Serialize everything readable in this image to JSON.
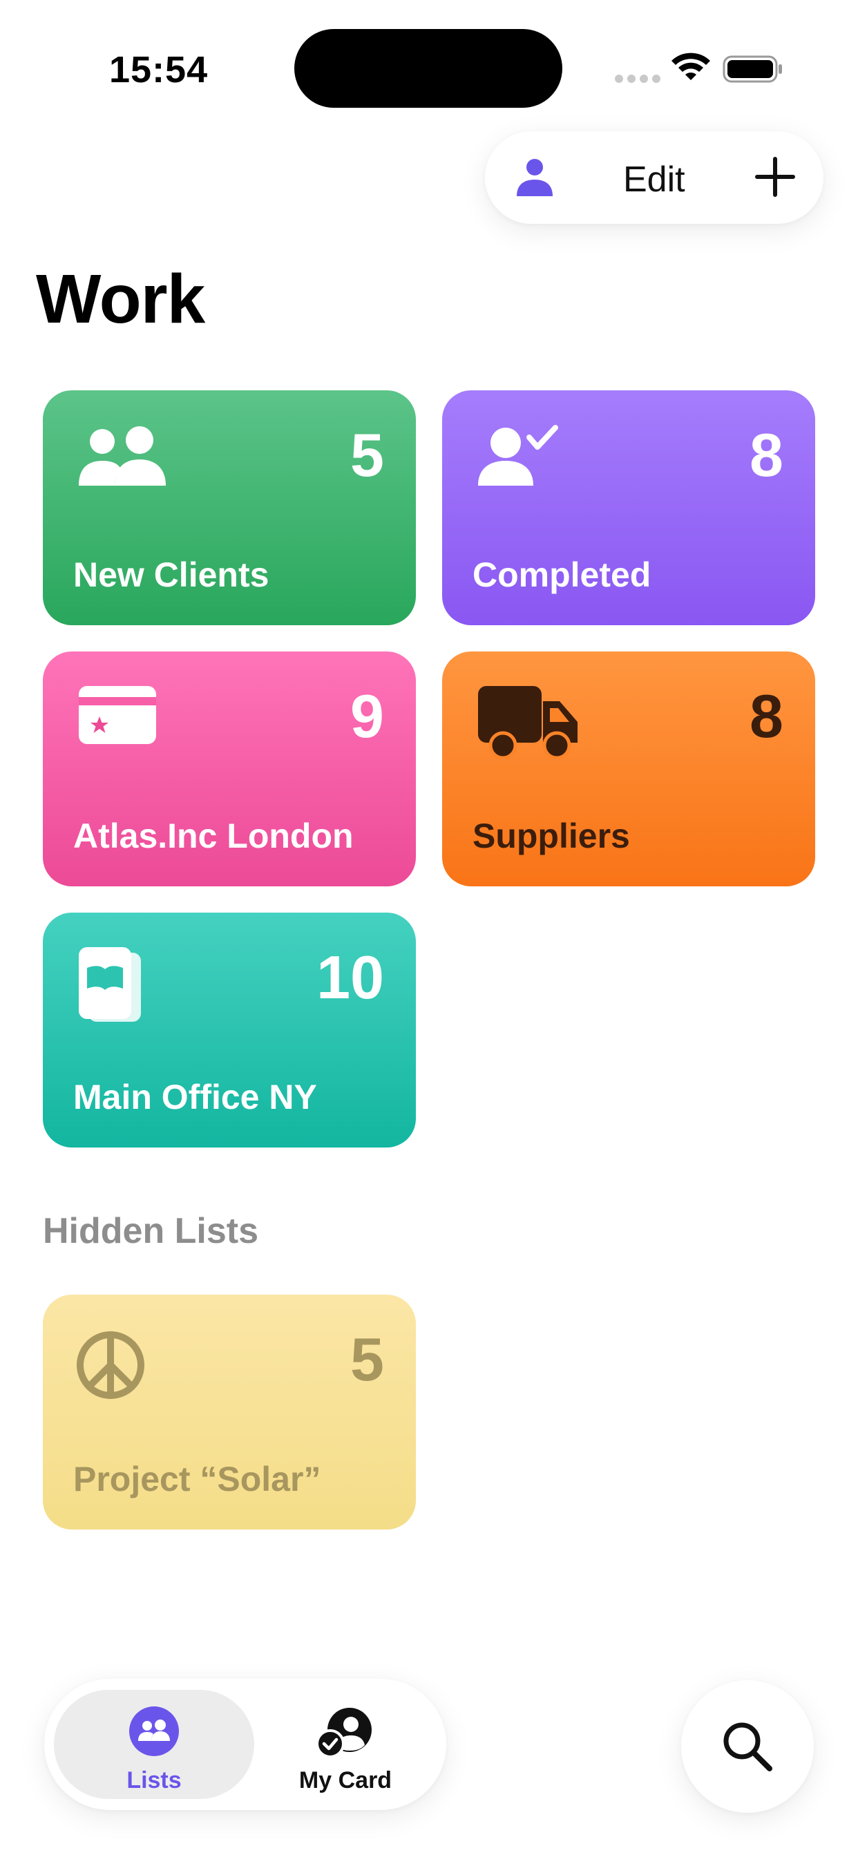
{
  "status_bar": {
    "time": "15:54"
  },
  "toolbar": {
    "edit_label": "Edit",
    "icons": [
      "person-icon",
      "plus-icon"
    ]
  },
  "page": {
    "title": "Work"
  },
  "lists": [
    {
      "label": "New Clients",
      "count": "5",
      "icon": "two-people-icon",
      "color": "#34b26b"
    },
    {
      "label": "Completed",
      "count": "8",
      "icon": "person-checkmark-icon",
      "color": "#9a6af8"
    },
    {
      "label": "Atlas.Inc London",
      "count": "9",
      "icon": "credit-card-star-icon",
      "color": "#f65ea8"
    },
    {
      "label": "Suppliers",
      "count": "8",
      "icon": "truck-icon",
      "color": "#fb8428"
    },
    {
      "label": "Main Office NY",
      "count": "10",
      "icon": "book-icon",
      "color": "#2cc4b0"
    }
  ],
  "hidden_section": {
    "title": "Hidden Lists",
    "lists": [
      {
        "label": "Project “Solar”",
        "count": "5",
        "icon": "peace-sign-icon",
        "color": "#f7e19a"
      }
    ]
  },
  "tab_bar": {
    "tabs": [
      {
        "label": "Lists",
        "icon": "people-circle-icon",
        "selected": true
      },
      {
        "label": "My Card",
        "icon": "person-circle-check-icon",
        "selected": false
      }
    ],
    "search_icon": "magnifier-icon"
  }
}
